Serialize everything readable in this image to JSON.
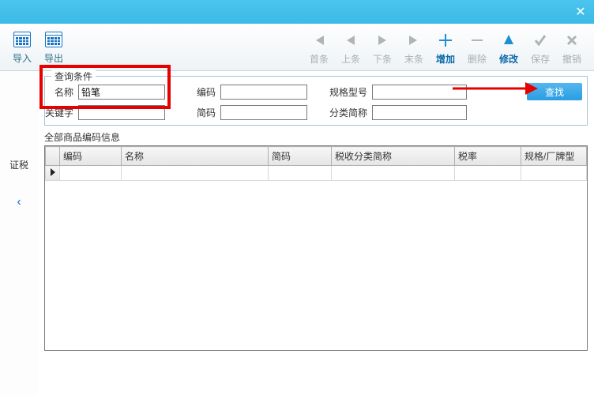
{
  "window": {
    "close_tooltip": "关闭"
  },
  "toolbar": {
    "import": "导入",
    "export": "导出",
    "first": "首条",
    "prev": "上条",
    "next": "下条",
    "last": "末条",
    "add": "增加",
    "delete": "删除",
    "modify": "修改",
    "save": "保存",
    "undo": "撤销"
  },
  "sidebar": {
    "label": "证税",
    "arrow": "‹"
  },
  "query": {
    "legend": "查询条件",
    "name_label": "名称",
    "name_value": "铅笔",
    "code_label": "编码",
    "code_value": "",
    "spec_label": "规格型号",
    "spec_value": "",
    "keyword_label": "关键字",
    "keyword_value": "",
    "shortcode_label": "简码",
    "shortcode_value": "",
    "catshort_label": "分类简称",
    "catshort_value": "",
    "search_btn": "查找"
  },
  "grid": {
    "title": "全部商品编码信息",
    "columns": [
      "编码",
      "名称",
      "简码",
      "税收分类简称",
      "税率",
      "规格/厂牌型"
    ]
  }
}
